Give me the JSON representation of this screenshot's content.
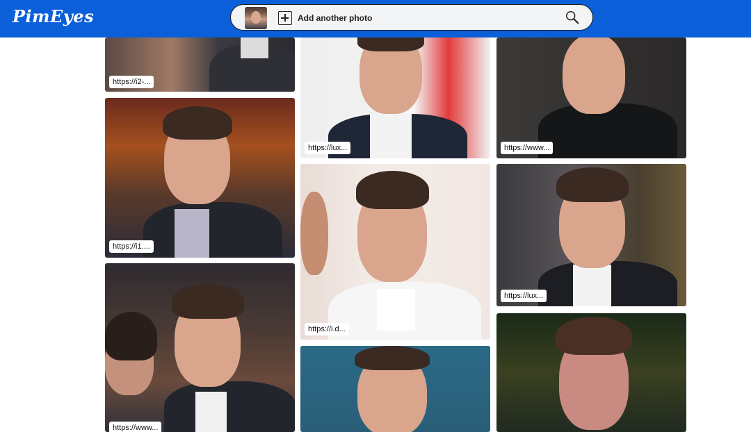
{
  "header": {
    "logo": "PimEyes",
    "search": {
      "add_photo_label": "Add another photo"
    }
  },
  "results": [
    {
      "url": "https://i2-..."
    },
    {
      "url": "https://lux..."
    },
    {
      "url": "https://www..."
    },
    {
      "url": "https://i1...."
    },
    {
      "url": "https://i.d..."
    },
    {
      "url": "https://lux..."
    },
    {
      "url": "https://www..."
    }
  ],
  "colors": {
    "header_bg": "#0b5fd8"
  }
}
